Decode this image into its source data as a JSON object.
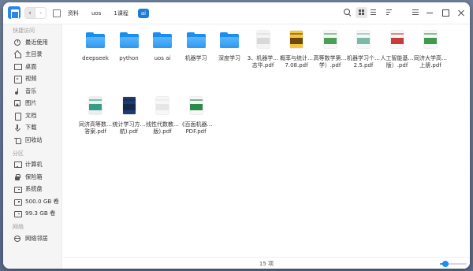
{
  "toolbar": {
    "breadcrumbs": [
      "资料",
      "uos",
      "1课程",
      "ai"
    ],
    "active_crumb_index": 3
  },
  "sidebar": {
    "sections": [
      {
        "title": "快捷访问",
        "items": [
          {
            "icon": "clock-icon",
            "label": "最近使用"
          },
          {
            "icon": "home-icon",
            "label": "主目录"
          },
          {
            "icon": "desktop-icon",
            "label": "桌面"
          },
          {
            "icon": "video-icon",
            "label": "视频"
          },
          {
            "icon": "music-icon",
            "label": "音乐"
          },
          {
            "icon": "picture-icon",
            "label": "图片"
          },
          {
            "icon": "document-icon",
            "label": "文档"
          },
          {
            "icon": "download-icon",
            "label": "下载"
          },
          {
            "icon": "trash-icon",
            "label": "回收站"
          }
        ]
      },
      {
        "title": "分区",
        "items": [
          {
            "icon": "computer-icon",
            "label": "计算机"
          },
          {
            "icon": "safe-icon",
            "label": "保险箱"
          },
          {
            "icon": "disk-icon",
            "label": "系统盘"
          },
          {
            "icon": "disk-icon",
            "label": "500.0 GB 卷"
          },
          {
            "icon": "disk-icon",
            "label": "99.3 GB 卷"
          }
        ]
      },
      {
        "title": "网络",
        "items": [
          {
            "icon": "network-icon",
            "label": "网络邻居"
          }
        ]
      }
    ]
  },
  "files": [
    {
      "type": "folder",
      "label": "deepseek"
    },
    {
      "type": "folder",
      "label": "python"
    },
    {
      "type": "folder",
      "label": "uos ai"
    },
    {
      "type": "folder",
      "label": "机器学习"
    },
    {
      "type": "folder",
      "label": "深度学习"
    },
    {
      "type": "pdf",
      "label": "3、机器学…志华.pdf",
      "cover": "#f4f4f4",
      "band": "#d8d8d8"
    },
    {
      "type": "pdf",
      "label": "概率与统计…7.08.pdf",
      "cover": "#f5c63c",
      "band": "#6a4a10"
    },
    {
      "type": "pdf",
      "label": "高等数学第…学）.pdf",
      "cover": "#f7f7f7",
      "band": "#4aa05a"
    },
    {
      "type": "pdf",
      "label": "机器学习个…2.5.pdf",
      "cover": "#f7f7f7",
      "band": "#7ab8a8"
    },
    {
      "type": "pdf",
      "label": "人工智能基…版）.pdf",
      "cover": "#f7f7f7",
      "band": "#c93a3a"
    },
    {
      "type": "pdf",
      "label": "同济大学高…上册.pdf",
      "cover": "#f7f7f7",
      "band": "#3e9a4e"
    },
    {
      "type": "pdf",
      "label": "同济高等数…答案.pdf",
      "cover": "#e6f2f0",
      "band": "#3a9a8a"
    },
    {
      "type": "pdf",
      "label": "统计学习方…航).pdf",
      "cover": "#1e3a6e",
      "band": "#14284e"
    },
    {
      "type": "pdf",
      "label": "线性代数教…版).pdf",
      "cover": "#f7f7f7",
      "band": "#e6e6e6"
    },
    {
      "type": "pdf",
      "label": "《百面机器…PDF.pdf",
      "cover": "#f7f7f7",
      "band": "#2a8a4a"
    }
  ],
  "status": {
    "item_count": "15 项",
    "zoom_level": 0.2
  },
  "colors": {
    "accent": "#1a8ef0",
    "folder": "#2d98ee",
    "active_crumb": "#1e7bd8"
  }
}
